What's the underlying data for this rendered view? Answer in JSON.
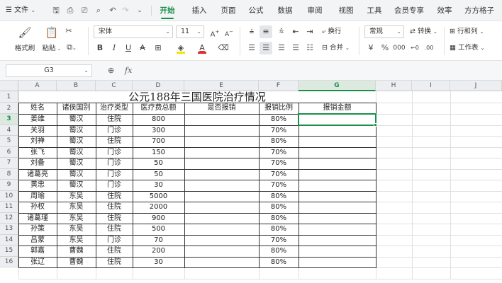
{
  "app": {
    "file_menu": "文件",
    "tabs": [
      "开始",
      "插入",
      "页面",
      "公式",
      "数据",
      "审阅",
      "视图",
      "工具",
      "会员专享",
      "效率",
      "方方格子"
    ],
    "active_tab": "开始",
    "accent_color": "#1a8f4a"
  },
  "ribbon": {
    "format_painter": "格式刷",
    "paste": "粘贴",
    "font_name": "宋体",
    "font_size": "11",
    "wrap_text": "换行",
    "merge": "合并",
    "number_format": "常规",
    "convert": "转换",
    "rows_cols": "行和列",
    "worksheet": "工作表"
  },
  "formula_bar": {
    "cell_ref": "G3",
    "fx": "fx",
    "content": ""
  },
  "sheet": {
    "columns": [
      "A",
      "B",
      "C",
      "D",
      "E",
      "F",
      "G",
      "H",
      "I",
      "J"
    ],
    "active_column": "G",
    "active_row": 3,
    "title": "公元188年三国医院治疗情况",
    "headers": [
      "姓名",
      "诸侯国别",
      "治疗类型",
      "医疗费总额",
      "是否报销",
      "报销比例",
      "报销金额"
    ],
    "rows": [
      {
        "row": 3,
        "cells": [
          "姜维",
          "蜀汉",
          "住院",
          "800",
          "",
          "80%",
          ""
        ]
      },
      {
        "row": 4,
        "cells": [
          "关羽",
          "蜀汉",
          "门诊",
          "300",
          "",
          "70%",
          ""
        ]
      },
      {
        "row": 5,
        "cells": [
          "刘禅",
          "蜀汉",
          "住院",
          "700",
          "",
          "80%",
          ""
        ]
      },
      {
        "row": 6,
        "cells": [
          "张飞",
          "蜀汉",
          "门诊",
          "150",
          "",
          "70%",
          ""
        ]
      },
      {
        "row": 7,
        "cells": [
          "刘备",
          "蜀汉",
          "门诊",
          "50",
          "",
          "70%",
          ""
        ]
      },
      {
        "row": 8,
        "cells": [
          "诸葛亮",
          "蜀汉",
          "门诊",
          "50",
          "",
          "70%",
          ""
        ]
      },
      {
        "row": 9,
        "cells": [
          "黄忠",
          "蜀汉",
          "门诊",
          "30",
          "",
          "70%",
          ""
        ]
      },
      {
        "row": 10,
        "cells": [
          "周瑜",
          "东吴",
          "住院",
          "5000",
          "",
          "80%",
          ""
        ]
      },
      {
        "row": 11,
        "cells": [
          "孙权",
          "东吴",
          "住院",
          "2000",
          "",
          "80%",
          ""
        ]
      },
      {
        "row": 12,
        "cells": [
          "诸葛瑾",
          "东吴",
          "住院",
          "900",
          "",
          "80%",
          ""
        ]
      },
      {
        "row": 13,
        "cells": [
          "孙策",
          "东吴",
          "住院",
          "500",
          "",
          "80%",
          ""
        ]
      },
      {
        "row": 14,
        "cells": [
          "吕蒙",
          "东吴",
          "门诊",
          "70",
          "",
          "70%",
          ""
        ]
      },
      {
        "row": 15,
        "cells": [
          "郭嘉",
          "曹魏",
          "住院",
          "200",
          "",
          "80%",
          ""
        ]
      },
      {
        "row": 16,
        "cells": [
          "张辽",
          "曹魏",
          "住院",
          "30",
          "",
          "80%",
          ""
        ]
      }
    ]
  }
}
